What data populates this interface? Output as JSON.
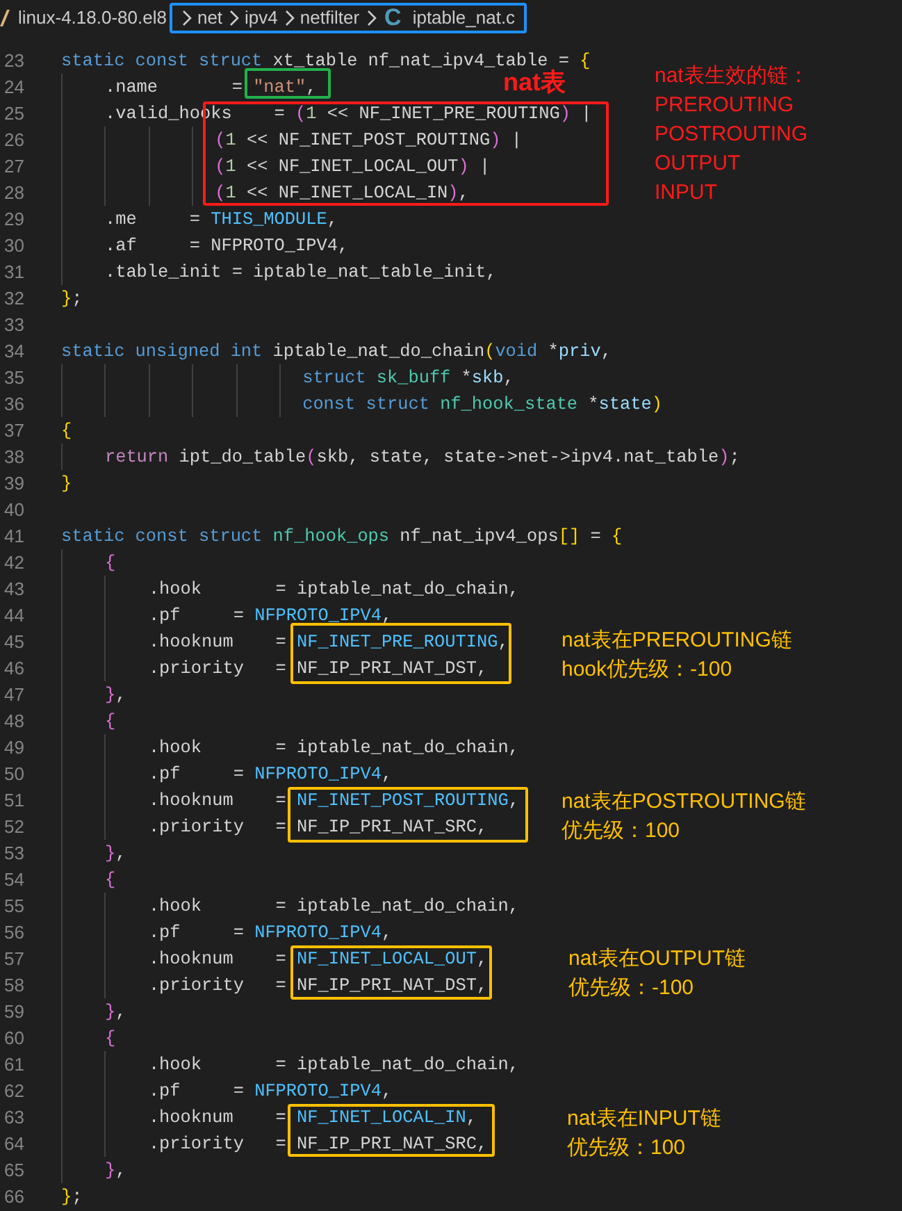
{
  "breadcrumb": {
    "items": [
      {
        "label": "linux-4.18.0-80.el8"
      },
      {
        "label": "net"
      },
      {
        "label": "ipv4"
      },
      {
        "label": "netfilter"
      },
      {
        "label": "iptable_nat.c",
        "file_icon": "C"
      }
    ]
  },
  "lines": [
    {
      "number": "23",
      "tokens": [
        {
          "t": "static const struct ",
          "kind": "kw"
        },
        {
          "t": "xt_table nf_nat_ipv4_table = ",
          "kind": "plain"
        },
        {
          "t": "{",
          "kind": "bracket"
        }
      ]
    },
    {
      "number": "24",
      "tokens": [
        {
          "t": "    .name       = ",
          "kind": "plain"
        },
        {
          "t": "\"nat\"",
          "kind": "str"
        },
        {
          "t": ",",
          "kind": "plain"
        }
      ]
    },
    {
      "number": "25",
      "tokens": [
        {
          "t": "    .valid_hooks    = ",
          "kind": "plain"
        },
        {
          "t": "(",
          "kind": "bracket2"
        },
        {
          "t": "1",
          "kind": "num"
        },
        {
          "t": " << NF_INET_PRE_ROUTING",
          "kind": "plain"
        },
        {
          "t": ")",
          "kind": "bracket2"
        },
        {
          "t": " |",
          "kind": "plain"
        }
      ]
    },
    {
      "number": "26",
      "tokens": [
        {
          "t": "              (",
          "kind": "bracket2"
        },
        {
          "t": "1",
          "kind": "num"
        },
        {
          "t": " << NF_INET_POST_ROUTING",
          "kind": "plain"
        },
        {
          "t": ")",
          "kind": "bracket2"
        },
        {
          "t": " |",
          "kind": "plain"
        }
      ]
    },
    {
      "number": "27",
      "tokens": [
        {
          "t": "              (",
          "kind": "bracket2"
        },
        {
          "t": "1",
          "kind": "num"
        },
        {
          "t": " << NF_INET_LOCAL_OUT",
          "kind": "plain"
        },
        {
          "t": ")",
          "kind": "bracket2"
        },
        {
          "t": " |",
          "kind": "plain"
        }
      ]
    },
    {
      "number": "28",
      "tokens": [
        {
          "t": "              (",
          "kind": "bracket2"
        },
        {
          "t": "1",
          "kind": "num"
        },
        {
          "t": " << NF_INET_LOCAL_IN",
          "kind": "plain"
        },
        {
          "t": ")",
          "kind": "bracket2"
        },
        {
          "t": ",",
          "kind": "plain"
        }
      ]
    },
    {
      "number": "29",
      "tokens": [
        {
          "t": "    .me     = ",
          "kind": "plain"
        },
        {
          "t": "THIS_MODULE",
          "kind": "macro"
        },
        {
          "t": ",",
          "kind": "plain"
        }
      ]
    },
    {
      "number": "30",
      "tokens": [
        {
          "t": "    .af     = NFPROTO_IPV4,",
          "kind": "plain"
        }
      ]
    },
    {
      "number": "31",
      "tokens": [
        {
          "t": "    .table_init = iptable_nat_table_init,",
          "kind": "plain"
        }
      ]
    },
    {
      "number": "32",
      "tokens": [
        {
          "t": "}",
          "kind": "bracket"
        },
        {
          "t": ";",
          "kind": "plain"
        }
      ]
    },
    {
      "number": "33"
    },
    {
      "number": "34",
      "tokens": [
        {
          "t": "static unsigned int ",
          "kind": "kw"
        },
        {
          "t": "iptable_nat_do_chain",
          "kind": "plain"
        },
        {
          "t": "(",
          "kind": "bracket"
        },
        {
          "t": "void ",
          "kind": "kw"
        },
        {
          "t": "*",
          "kind": "plain"
        },
        {
          "t": "priv",
          "kind": "var"
        },
        {
          "t": ",",
          "kind": "plain"
        }
      ]
    },
    {
      "number": "35",
      "tokens": [
        {
          "t": "                      struct ",
          "kind": "kw"
        },
        {
          "t": "sk_buff ",
          "kind": "type"
        },
        {
          "t": "*",
          "kind": "plain"
        },
        {
          "t": "skb",
          "kind": "var"
        },
        {
          "t": ",",
          "kind": "plain"
        }
      ]
    },
    {
      "number": "36",
      "tokens": [
        {
          "t": "                      const struct ",
          "kind": "kw"
        },
        {
          "t": "nf_hook_state ",
          "kind": "type"
        },
        {
          "t": "*",
          "kind": "plain"
        },
        {
          "t": "state",
          "kind": "var"
        },
        {
          "t": ")",
          "kind": "bracket"
        }
      ]
    },
    {
      "number": "37",
      "tokens": [
        {
          "t": "{",
          "kind": "bracket"
        }
      ]
    },
    {
      "number": "38",
      "tokens": [
        {
          "t": "    return ",
          "kind": "ctl"
        },
        {
          "t": "ipt_do_table",
          "kind": "plain"
        },
        {
          "t": "(",
          "kind": "bracket2"
        },
        {
          "t": "skb, state, state->net->ipv4.nat_table",
          "kind": "plain"
        },
        {
          "t": ")",
          "kind": "bracket2"
        },
        {
          "t": ";",
          "kind": "plain"
        }
      ]
    },
    {
      "number": "39",
      "tokens": [
        {
          "t": "}",
          "kind": "bracket"
        }
      ]
    },
    {
      "number": "40"
    },
    {
      "number": "41",
      "tokens": [
        {
          "t": "static const struct ",
          "kind": "kw"
        },
        {
          "t": "nf_hook_ops ",
          "kind": "type"
        },
        {
          "t": "nf_nat_ipv4_ops",
          "kind": "plain"
        },
        {
          "t": "[]",
          "kind": "bracket"
        },
        {
          "t": " = ",
          "kind": "plain"
        },
        {
          "t": "{",
          "kind": "bracket"
        }
      ]
    },
    {
      "number": "42",
      "tokens": [
        {
          "t": "    {",
          "kind": "bracket2"
        }
      ]
    },
    {
      "number": "43",
      "tokens": [
        {
          "t": "        .hook       = iptable_nat_do_chain,",
          "kind": "plain"
        }
      ]
    },
    {
      "number": "44",
      "tokens": [
        {
          "t": "        .pf     = ",
          "kind": "plain"
        },
        {
          "t": "NFPROTO_IPV4",
          "kind": "macro"
        },
        {
          "t": ",",
          "kind": "plain"
        }
      ]
    },
    {
      "number": "45",
      "tokens": [
        {
          "t": "        .hooknum    = ",
          "kind": "plain"
        },
        {
          "t": "NF_INET_PRE_ROUTING",
          "kind": "macro"
        },
        {
          "t": ",",
          "kind": "plain"
        }
      ]
    },
    {
      "number": "46",
      "tokens": [
        {
          "t": "        .priority   = NF_IP_PRI_NAT_DST,",
          "kind": "plain"
        }
      ]
    },
    {
      "number": "47",
      "tokens": [
        {
          "t": "    }",
          "kind": "bracket2"
        },
        {
          "t": ",",
          "kind": "plain"
        }
      ]
    },
    {
      "number": "48",
      "tokens": [
        {
          "t": "    {",
          "kind": "bracket2"
        }
      ]
    },
    {
      "number": "49",
      "tokens": [
        {
          "t": "        .hook       = iptable_nat_do_chain,",
          "kind": "plain"
        }
      ]
    },
    {
      "number": "50",
      "tokens": [
        {
          "t": "        .pf     = ",
          "kind": "plain"
        },
        {
          "t": "NFPROTO_IPV4",
          "kind": "macro"
        },
        {
          "t": ",",
          "kind": "plain"
        }
      ]
    },
    {
      "number": "51",
      "tokens": [
        {
          "t": "        .hooknum    = ",
          "kind": "plain"
        },
        {
          "t": "NF_INET_POST_ROUTING",
          "kind": "macro"
        },
        {
          "t": ",",
          "kind": "plain"
        }
      ]
    },
    {
      "number": "52",
      "tokens": [
        {
          "t": "        .priority   = NF_IP_PRI_NAT_SRC,",
          "kind": "plain"
        }
      ]
    },
    {
      "number": "53",
      "tokens": [
        {
          "t": "    }",
          "kind": "bracket2"
        },
        {
          "t": ",",
          "kind": "plain"
        }
      ]
    },
    {
      "number": "54",
      "tokens": [
        {
          "t": "    {",
          "kind": "bracket2"
        }
      ]
    },
    {
      "number": "55",
      "tokens": [
        {
          "t": "        .hook       = iptable_nat_do_chain,",
          "kind": "plain"
        }
      ]
    },
    {
      "number": "56",
      "tokens": [
        {
          "t": "        .pf     = ",
          "kind": "plain"
        },
        {
          "t": "NFPROTO_IPV4",
          "kind": "macro"
        },
        {
          "t": ",",
          "kind": "plain"
        }
      ]
    },
    {
      "number": "57",
      "tokens": [
        {
          "t": "        .hooknum    = ",
          "kind": "plain"
        },
        {
          "t": "NF_INET_LOCAL_OUT",
          "kind": "macro"
        },
        {
          "t": ",",
          "kind": "plain"
        }
      ]
    },
    {
      "number": "58",
      "tokens": [
        {
          "t": "        .priority   = NF_IP_PRI_NAT_DST,",
          "kind": "plain"
        }
      ]
    },
    {
      "number": "59",
      "tokens": [
        {
          "t": "    }",
          "kind": "bracket2"
        },
        {
          "t": ",",
          "kind": "plain"
        }
      ]
    },
    {
      "number": "60",
      "tokens": [
        {
          "t": "    {",
          "kind": "bracket2"
        }
      ]
    },
    {
      "number": "61",
      "tokens": [
        {
          "t": "        .hook       = iptable_nat_do_chain,",
          "kind": "plain"
        }
      ]
    },
    {
      "number": "62",
      "tokens": [
        {
          "t": "        .pf     = ",
          "kind": "plain"
        },
        {
          "t": "NFPROTO_IPV4",
          "kind": "macro"
        },
        {
          "t": ",",
          "kind": "plain"
        }
      ]
    },
    {
      "number": "63",
      "tokens": [
        {
          "t": "        .hooknum    = ",
          "kind": "plain"
        },
        {
          "t": "NF_INET_LOCAL_IN",
          "kind": "macro"
        },
        {
          "t": ",",
          "kind": "plain"
        }
      ]
    },
    {
      "number": "64",
      "tokens": [
        {
          "t": "        .priority   = NF_IP_PRI_NAT_SRC,",
          "kind": "plain"
        }
      ]
    },
    {
      "number": "65",
      "tokens": [
        {
          "t": "    }",
          "kind": "bracket2"
        },
        {
          "t": ",",
          "kind": "plain"
        }
      ]
    },
    {
      "number": "66",
      "tokens": [
        {
          "t": "}",
          "kind": "bracket"
        },
        {
          "t": ";",
          "kind": "plain"
        }
      ]
    }
  ],
  "annotations": [
    {
      "kind": "frame",
      "color": "#1e90ff"
    },
    {
      "kind": "frame",
      "color": "#22b14c"
    },
    {
      "kind": "frame",
      "color": "#ff1a1a"
    },
    {
      "kind": "note",
      "color": "#ff1a1a",
      "lines": [
        "nat表"
      ]
    },
    {
      "kind": "note",
      "color": "#ff1a1a",
      "lines": [
        "nat表生效的链：",
        "PREROUTING",
        "POSTROUTING",
        "OUTPUT",
        "INPUT"
      ]
    },
    {
      "kind": "frame",
      "color": "#ffc000"
    },
    {
      "kind": "note",
      "color": "#ffc000",
      "lines": [
        "nat表在PREROUTING链",
        "hook优先级：-100"
      ]
    },
    {
      "kind": "frame",
      "color": "#ffc000"
    },
    {
      "kind": "note",
      "color": "#ffc000",
      "lines": [
        "nat表在POSTROUTING链",
        "优先级：100"
      ]
    },
    {
      "kind": "frame",
      "color": "#ffc000"
    },
    {
      "kind": "note",
      "color": "#ffc000",
      "lines": [
        "nat表在OUTPUT链",
        "优先级：-100"
      ]
    },
    {
      "kind": "frame",
      "color": "#ffc000"
    },
    {
      "kind": "note",
      "color": "#ffc000",
      "lines": [
        "nat表在INPUT链",
        "优先级：100"
      ]
    }
  ]
}
